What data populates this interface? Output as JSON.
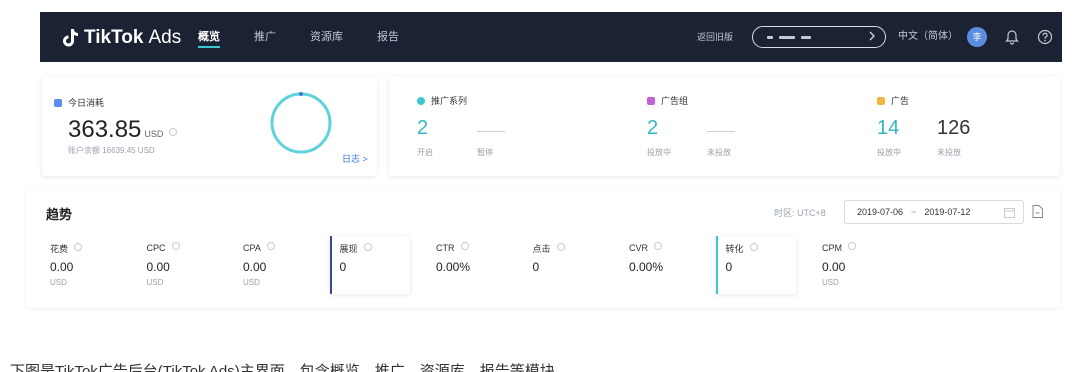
{
  "header": {
    "brand": "TikTok",
    "brand_suffix": "Ads",
    "nav": [
      {
        "label": "概览",
        "active": true
      },
      {
        "label": "推广",
        "active": false
      },
      {
        "label": "资源库",
        "active": false
      },
      {
        "label": "报告",
        "active": false
      }
    ],
    "back_to_old": "返回旧版",
    "language": "中文（简体）",
    "avatar_initial": "李"
  },
  "spend_card": {
    "title": "今日消耗",
    "amount": "363.85",
    "unit": "USD",
    "balance": "账户余额 16639.45 USD",
    "logs_link": "日志 >",
    "accent_color": "#5b8def"
  },
  "stats": {
    "campaign": {
      "title": "推广系列",
      "accent_color": "#3cc7d0",
      "items": [
        {
          "value": "2",
          "label": "开启"
        },
        {
          "value": "——",
          "label": "暂停"
        }
      ]
    },
    "adgroup": {
      "title": "广告组",
      "accent_color": "#c063d8",
      "items": [
        {
          "value": "2",
          "label": "投放中"
        },
        {
          "value": "——",
          "label": "未投放"
        }
      ]
    },
    "ad": {
      "title": "广告",
      "accent_color": "#f2b541",
      "items": [
        {
          "value": "14",
          "label": "投放中"
        },
        {
          "value": "126",
          "label": "未投放"
        }
      ]
    }
  },
  "trend": {
    "title": "趋势",
    "timezone": "时区: UTC+8",
    "date_start": "2019-07-06",
    "date_sep": "~",
    "date_end": "2019-07-12",
    "metrics": [
      {
        "name": "花费",
        "value": "0.00",
        "unit": "USD",
        "selected": false
      },
      {
        "name": "CPC",
        "value": "0.00",
        "unit": "USD",
        "selected": false
      },
      {
        "name": "CPA",
        "value": "0.00",
        "unit": "USD",
        "selected": false
      },
      {
        "name": "展现",
        "value": "0",
        "unit": "",
        "selected": true,
        "color": "#3a4a8a"
      },
      {
        "name": "CTR",
        "value": "0.00%",
        "unit": "",
        "selected": false
      },
      {
        "name": "点击",
        "value": "0",
        "unit": "",
        "selected": false
      },
      {
        "name": "CVR",
        "value": "0.00%",
        "unit": "",
        "selected": false
      },
      {
        "name": "转化",
        "value": "0",
        "unit": "",
        "selected": true,
        "color": "#3cc7d0"
      },
      {
        "name": "CPM",
        "value": "0.00",
        "unit": "USD",
        "selected": false
      }
    ]
  },
  "caption": "下图是TikTok广告后台(TikTok Ads)主界面，包含概览、推广、资源库、报告等模块"
}
